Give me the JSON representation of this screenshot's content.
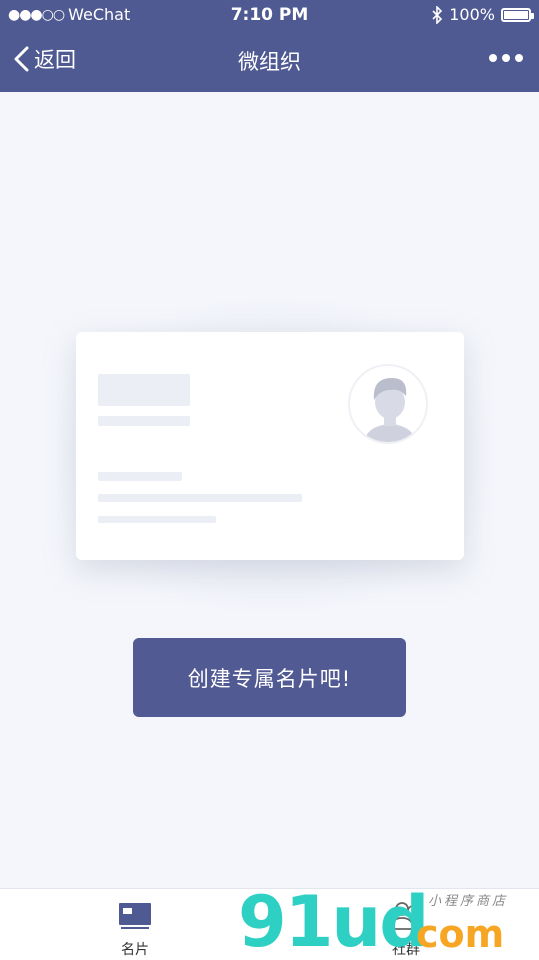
{
  "status_bar": {
    "signal": "●●●○○",
    "carrier": "WeChat",
    "time": "7:10 PM",
    "bluetooth_icon": "bluetooth-icon",
    "battery": "100%"
  },
  "nav": {
    "back_label": "返回",
    "title": "微组织",
    "more_icon": "more-dots-icon"
  },
  "main": {
    "card_placeholder_icon": "avatar-placeholder-icon",
    "cta_label": "创建专属名片吧!"
  },
  "tabbar": {
    "items": [
      {
        "label": "名片",
        "icon": "card-icon"
      },
      {
        "label": "社群",
        "icon": "group-icon"
      }
    ]
  },
  "watermark": {
    "logo": "91ud",
    "suffix": "com",
    "caption": "小程序商店"
  },
  "colors": {
    "brand": "#4f5992",
    "background": "#f4f6fb",
    "cta": "#515a93"
  }
}
